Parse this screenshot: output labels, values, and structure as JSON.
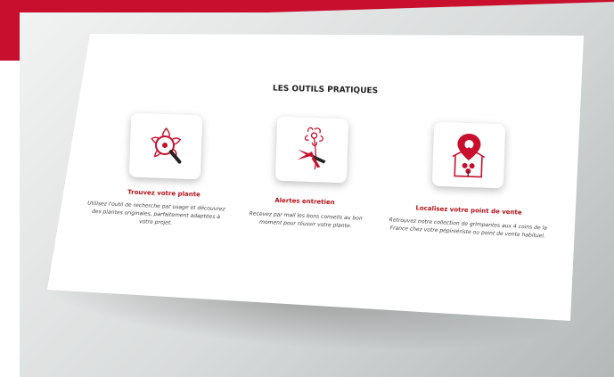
{
  "section_title": "LES OUTILS PRATIQUES",
  "accent_color": "#c8102e",
  "tools": [
    {
      "title": "Trouvez votre plante",
      "description": "Utilisez l'outil de recherche par usage et découvrez des plantes originales, parfaitement adaptées à votre projet.",
      "icon": "magnifier-flower-icon"
    },
    {
      "title": "Alertes entretien",
      "description": "Recevez par mail les bons conseils au bon moment pour réussir votre plante.",
      "icon": "pruning-shears-icon"
    },
    {
      "title": "Localisez votre point de vente",
      "description": "Retrouvez notre collection de grimpantes aux 4 coins de la France chez votre pépiniériste ou point de vente habituel.",
      "icon": "location-pin-house-icon"
    }
  ]
}
